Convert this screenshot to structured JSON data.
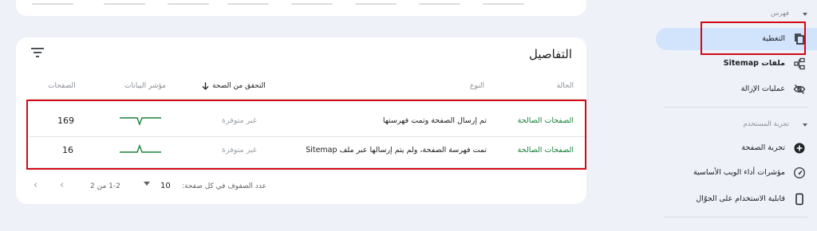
{
  "details": {
    "title": "التفاصيل",
    "headers": {
      "status": "الحالة",
      "type": "النوع",
      "freshness": "التحقق من الصحة",
      "trend": "مؤشر البيانات",
      "pages": "الصفحات"
    },
    "rows": [
      {
        "status": "الصفحات الصالحة",
        "type": "تم إرسال الصفحة وتمت فهرستها",
        "freshness": "غير متوفرة",
        "pages": "169",
        "trend_shape": "dip"
      },
      {
        "status": "الصفحات الصالحة",
        "type": "تمت فهرسة الصفحة، ولم يتم إرسالها عبر ملف Sitemap",
        "freshness": "غير متوفرة",
        "pages": "16",
        "trend_shape": "spike"
      }
    ],
    "footer": {
      "rows_per_page_label": "عدد الصفوف في كل صفحة:",
      "rows_per_page": "10",
      "range": "1-2 من 2"
    }
  },
  "sidebar": {
    "index_section": "فهرس",
    "items_index": [
      {
        "label": "التغطية",
        "icon": "copy-pages-icon"
      },
      {
        "label": "ملفات Sitemap",
        "icon": "sitemap-icon"
      },
      {
        "label": "عمليات الإزالة",
        "icon": "eye-off-icon"
      }
    ],
    "ux_section": "تجربة المستخدم",
    "items_ux": [
      {
        "label": "تجربة الصفحة",
        "icon": "add-circle-icon"
      },
      {
        "label": "مؤشرات أداء الويب الأساسية",
        "icon": "speedometer-icon"
      },
      {
        "label": "قابلية الاستخدام على الجوّال",
        "icon": "phone-icon"
      }
    ]
  },
  "colors": {
    "accent_green": "#188038",
    "highlight_red": "#d10a16",
    "active_nav": "#d2e3fc",
    "background": "#eef1f8"
  }
}
